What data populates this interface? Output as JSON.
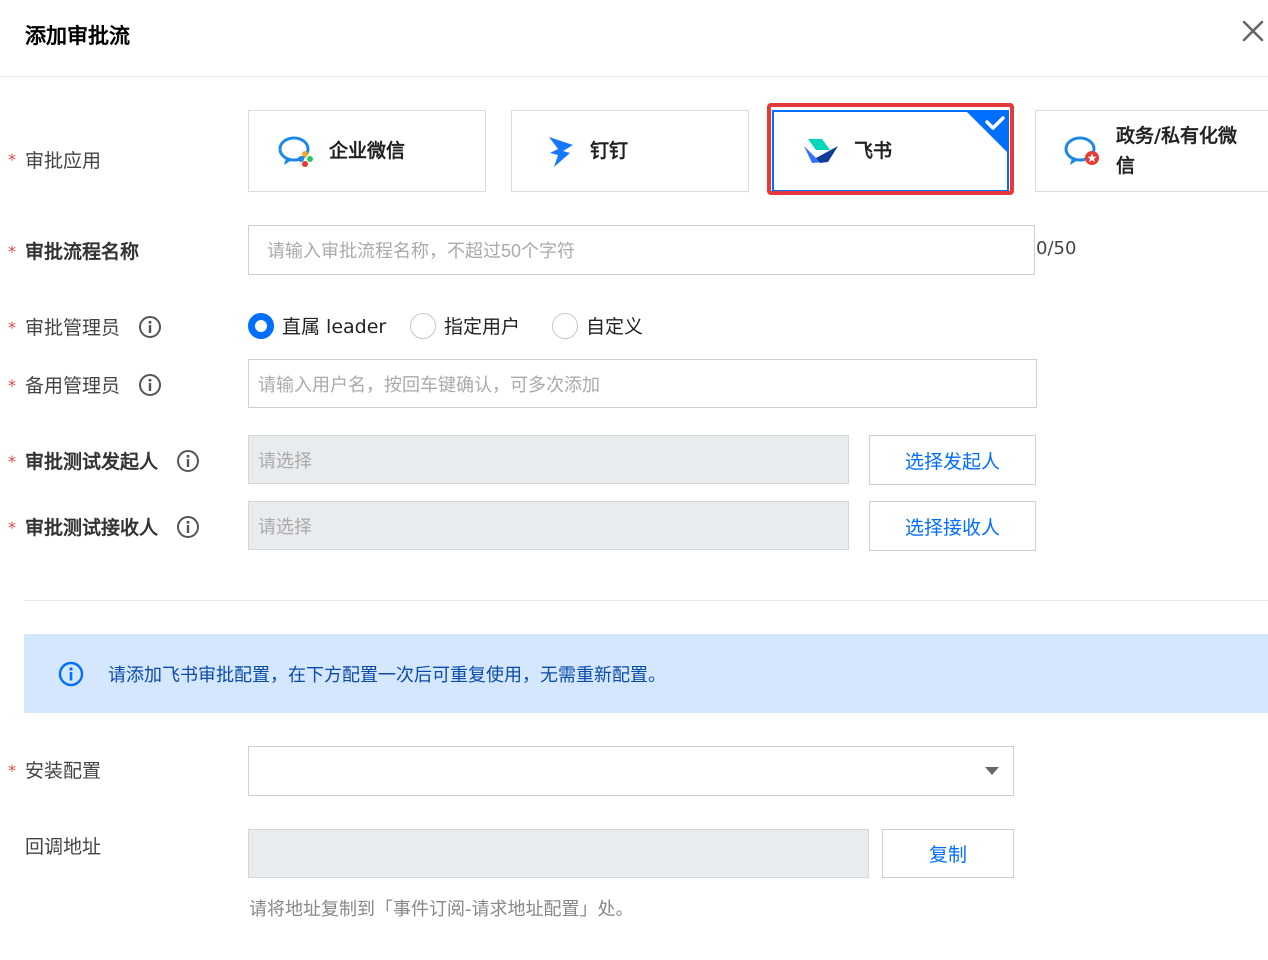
{
  "dialog": {
    "title": "添加审批流"
  },
  "apps": {
    "label": "审批应用",
    "items": [
      {
        "name": "企业微信",
        "icon": "wecom-icon"
      },
      {
        "name": "钉钉",
        "icon": "dingtalk-icon"
      },
      {
        "name": "飞书",
        "icon": "feishu-icon",
        "selected": true
      },
      {
        "name_line1": "政务/私有化微",
        "name_line2": "信",
        "icon": "gov-wecom-icon"
      }
    ]
  },
  "flow_name": {
    "label": "审批流程名称",
    "placeholder": "请输入审批流程名称，不超过50个字符",
    "counter": "0/50"
  },
  "admin": {
    "label": "审批管理员",
    "options": [
      "直属 leader",
      "指定用户",
      "自定义"
    ],
    "selected_index": 0
  },
  "backup_admin": {
    "label": "备用管理员",
    "placeholder": "请输入用户名，按回车键确认，可多次添加"
  },
  "test_initiator": {
    "label": "审批测试发起人",
    "placeholder": "请选择",
    "button": "选择发起人"
  },
  "test_receiver": {
    "label": "审批测试接收人",
    "placeholder": "请选择",
    "button": "选择接收人"
  },
  "alert": {
    "text": "请添加飞书审批配置，在下方配置一次后可重复使用，无需重新配置。"
  },
  "install_config": {
    "label": "安装配置",
    "value": ""
  },
  "callback": {
    "label": "回调地址",
    "value": "",
    "button": "复制",
    "hint": "请将地址复制到「事件订阅-请求地址配置」处。"
  },
  "colors": {
    "primary": "#006eff",
    "required": "#e54545",
    "highlight": "#e5383b",
    "alert_bg": "#d5e7ff"
  }
}
